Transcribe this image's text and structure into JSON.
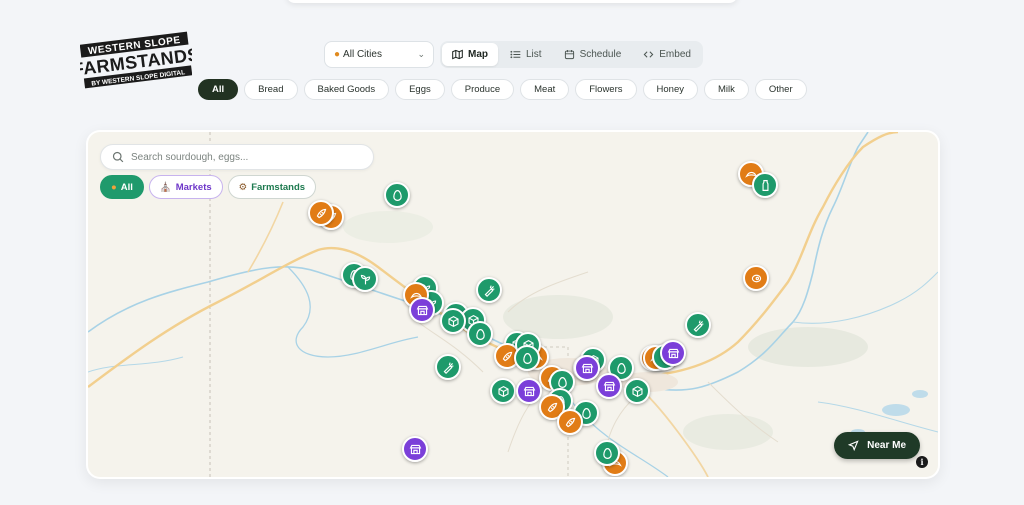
{
  "brand": {
    "line1": "WESTERN SLOPE",
    "line2": "FARMSTANDS",
    "line3": "BY WESTERN SLOPE DIGITAL"
  },
  "city_select": {
    "value": "All Cities",
    "icon": "pin-icon"
  },
  "view_tabs": [
    {
      "label": "Map",
      "icon": "map-icon",
      "active": true
    },
    {
      "label": "List",
      "icon": "list-icon",
      "active": false
    },
    {
      "label": "Schedule",
      "icon": "calendar-icon",
      "active": false
    },
    {
      "label": "Embed",
      "icon": "code-icon",
      "active": false
    }
  ],
  "categories": [
    "All",
    "Bread",
    "Baked Goods",
    "Eggs",
    "Produce",
    "Meat",
    "Flowers",
    "Honey",
    "Milk",
    "Other"
  ],
  "search": {
    "placeholder": "Search sourdough, eggs..."
  },
  "map_filters": [
    {
      "label": "All",
      "icon": "pin-icon"
    },
    {
      "label": "Markets",
      "icon": "market-icon"
    },
    {
      "label": "Farmstands",
      "icon": "tractor-icon"
    }
  ],
  "near_me": {
    "label": "Near Me",
    "icon": "navigation-icon"
  },
  "info": {
    "label": "i"
  },
  "colors": {
    "farmstand": "#1e9a6b",
    "bakery": "#e17c16",
    "market": "#7b3fd9",
    "primary_dark": "#223222"
  }
}
